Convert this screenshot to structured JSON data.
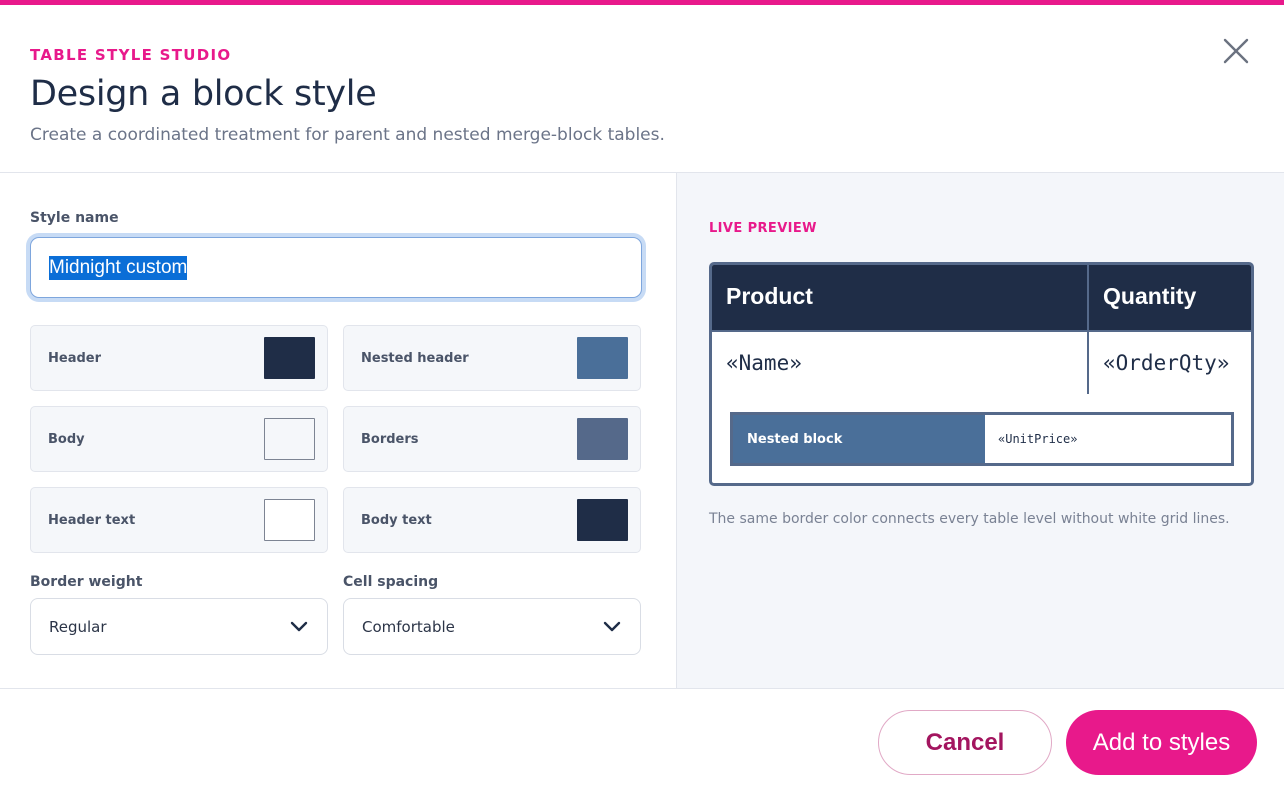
{
  "header": {
    "eyebrow": "TABLE STYLE STUDIO",
    "title": "Design a block style",
    "subtitle": "Create a coordinated treatment for parent and nested merge-block tables."
  },
  "form": {
    "style_name_label": "Style name",
    "style_name_value": "Midnight custom",
    "swatches": [
      {
        "label": "Header",
        "color": "#1f2d47"
      },
      {
        "label": "Nested header",
        "color": "#4a6f99"
      },
      {
        "label": "Body",
        "color": "#f5f7fa"
      },
      {
        "label": "Borders",
        "color": "#55698a"
      },
      {
        "label": "Header text",
        "color": "#ffffff"
      },
      {
        "label": "Body text",
        "color": "#1f2d47"
      }
    ],
    "border_weight_label": "Border weight",
    "border_weight_value": "Regular",
    "cell_spacing_label": "Cell spacing",
    "cell_spacing_value": "Comfortable"
  },
  "preview": {
    "label": "LIVE PREVIEW",
    "columns": [
      "Product",
      "Quantity"
    ],
    "cells": [
      "«Name»",
      "«OrderQty»"
    ],
    "nested_header": "Nested block",
    "nested_cell": "«UnitPrice»",
    "caption": "The same border color connects every table level without white grid lines."
  },
  "footer": {
    "cancel_label": "Cancel",
    "add_label": "Add to styles"
  },
  "colors": {
    "accent": "#e8198b",
    "header": "#1f2d47",
    "border": "#55698a"
  }
}
